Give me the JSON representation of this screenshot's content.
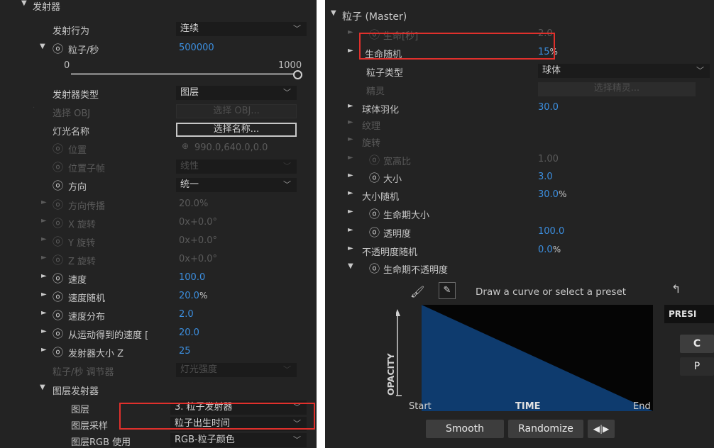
{
  "left": {
    "section_title": "发射器",
    "emit_behavior": {
      "label": "发射行为",
      "value": "连续"
    },
    "particles_per_sec": {
      "label": "粒子/秒",
      "value": "500000"
    },
    "slider": {
      "min": "0",
      "max": "1000",
      "level": 1.0
    },
    "emitter_type": {
      "label": "发射器类型",
      "value": "图层"
    },
    "select_obj": {
      "label": "选择 OBJ",
      "button": "选择 OBJ..."
    },
    "light_name": {
      "label": "灯光名称",
      "button": "选择名称..."
    },
    "position": {
      "label": "位置",
      "value": "990.0,640.0,0.0"
    },
    "position_subframe": {
      "label": "位置子帧",
      "value": "线性"
    },
    "direction": {
      "label": "方向",
      "value": "统一"
    },
    "direction_spread": {
      "label": "方向传播",
      "value": "20.0%"
    },
    "x_rotation": {
      "label": "X 旋转",
      "value": "0x+0.0°"
    },
    "y_rotation": {
      "label": "Y 旋转",
      "value": "0x+0.0°"
    },
    "z_rotation": {
      "label": "Z 旋转",
      "value": "0x+0.0°"
    },
    "velocity": {
      "label": "速度",
      "value": "100.0"
    },
    "velocity_random": {
      "label": "速度随机",
      "value": "20.0",
      "unit": "%"
    },
    "velocity_distribution": {
      "label": "速度分布",
      "value": "2.0"
    },
    "velocity_from_motion": {
      "label": "从运动得到的速度 [",
      "value": "20.0"
    },
    "emitter_size_z": {
      "label": "发射器大小 Z",
      "value": "25"
    },
    "particles_modifier": {
      "label": "粒子/秒 调节器",
      "value": "灯光强度"
    },
    "layer_emitter": {
      "label": "图层发射器"
    },
    "layer": {
      "label": "图层",
      "value": "3. 粒子发射器"
    },
    "layer_sampling": {
      "label": "图层采样",
      "value": "粒子出生时间"
    },
    "layer_rgb": {
      "label": "图层RGB 使用",
      "value": "RGB-粒子颜色"
    }
  },
  "right": {
    "section_title": "粒子 (Master)",
    "life": {
      "label": "生命[秒]",
      "value": "2.0"
    },
    "life_random": {
      "label": "生命随机",
      "value": "15",
      "unit": "%"
    },
    "particle_type": {
      "label": "粒子类型",
      "value": "球体"
    },
    "sprite": {
      "label": "精灵",
      "button": "选择精灵..."
    },
    "sphere_feather": {
      "label": "球体羽化",
      "value": "30.0"
    },
    "texture": {
      "label": "纹理"
    },
    "rotation": {
      "label": "旋转"
    },
    "aspect_ratio": {
      "label": "宽高比",
      "value": "1.00"
    },
    "size": {
      "label": "大小",
      "value": "3.0"
    },
    "size_random": {
      "label": "大小随机",
      "value": "30.0",
      "unit": "%"
    },
    "size_over_life": {
      "label": "生命期大小"
    },
    "opacity": {
      "label": "透明度",
      "value": "100.0"
    },
    "opacity_random": {
      "label": "不透明度随机",
      "value": "0.0",
      "unit": "%"
    },
    "opacity_over_life": {
      "label": "生命期不透明度"
    },
    "graph": {
      "hint": "Draw a curve or select a preset",
      "y_label": "OPACITY",
      "x_label": "TIME",
      "start": "Start",
      "end": "End",
      "presets": "PRESI",
      "side_btn_1": "C",
      "side_btn_2": "P",
      "fill_color": "#0e3b6e"
    },
    "buttons": {
      "smooth": "Smooth",
      "randomize": "Randomize",
      "flip": "◀|▶"
    }
  },
  "colors": {
    "value_blue": "#3c8fe0",
    "highlight_red": "#e0302c",
    "panel_bg": "#232323"
  }
}
